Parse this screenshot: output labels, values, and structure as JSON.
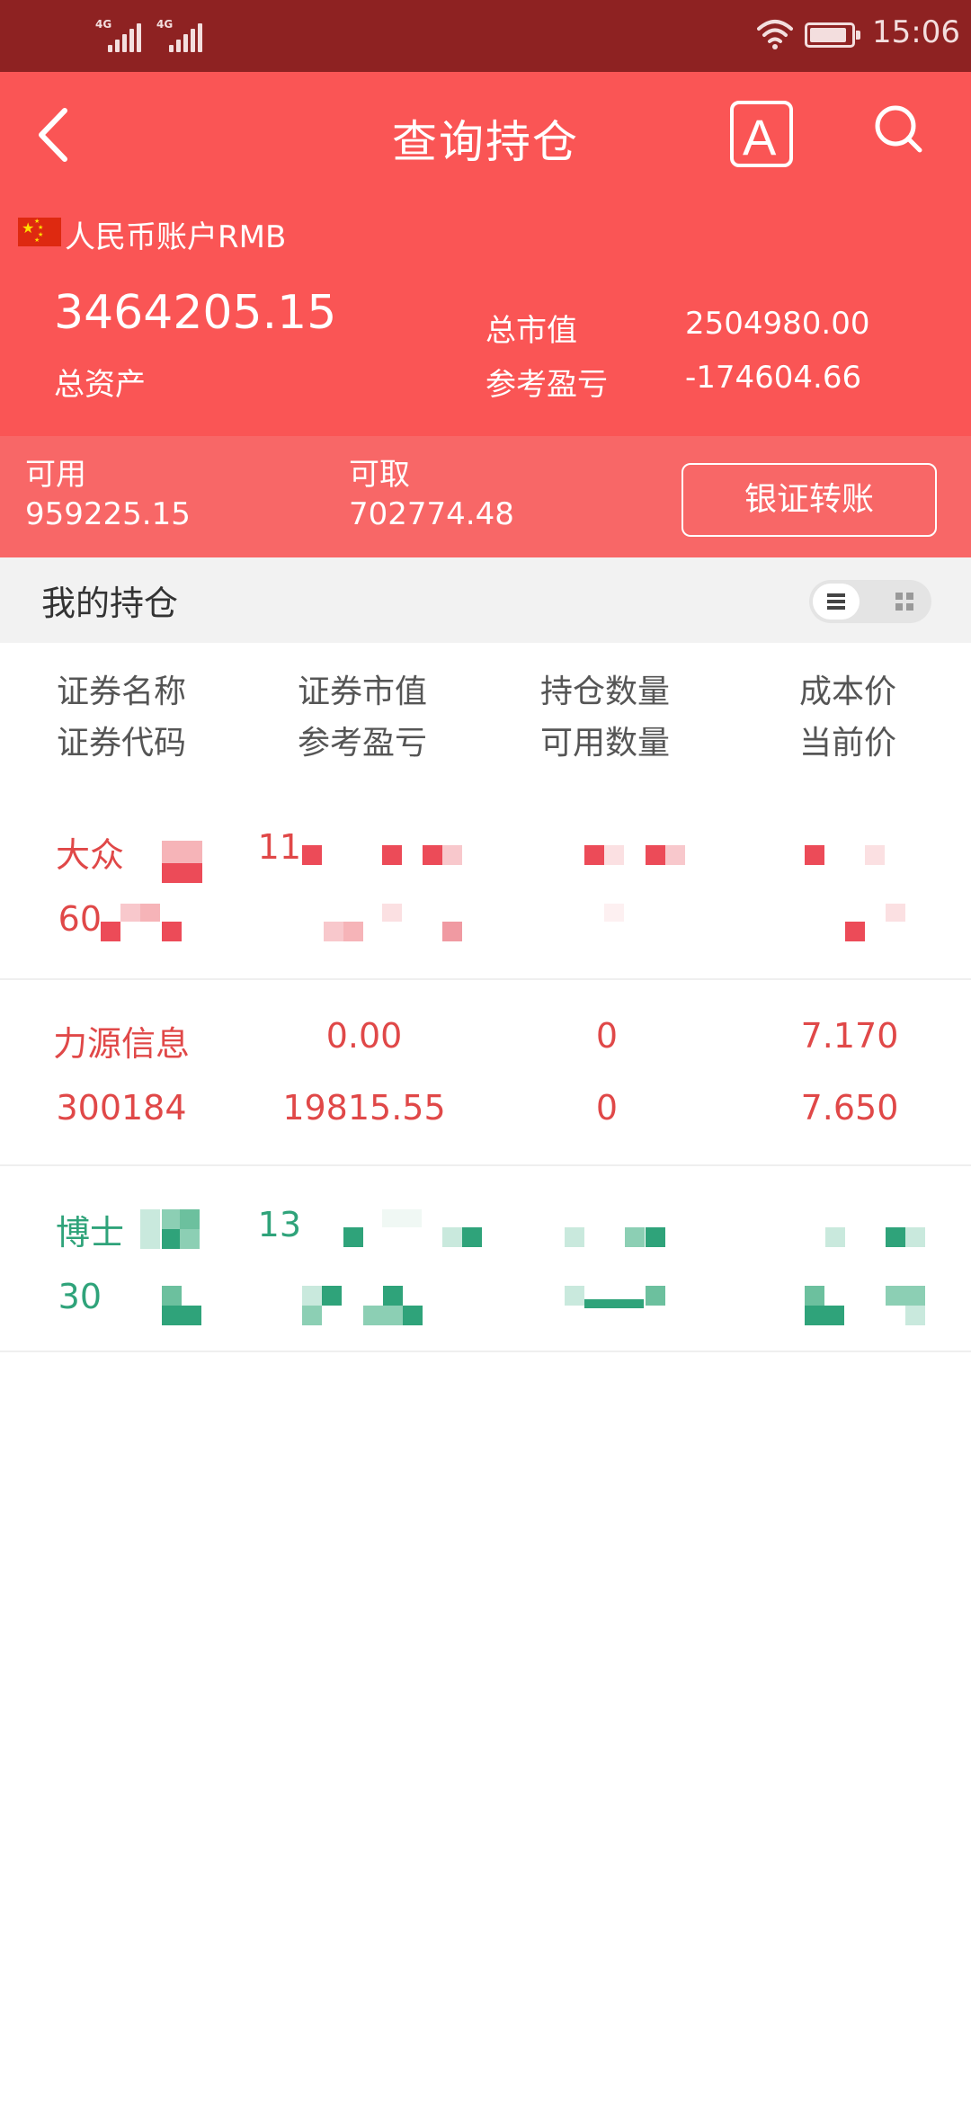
{
  "status_bar": {
    "sim1": "4G",
    "sim2": "4G",
    "time": "15:06",
    "battery_level": 0.9
  },
  "header": {
    "title": "查询持仓",
    "font_button_label": "A"
  },
  "account": {
    "label": "人民币账户RMB",
    "total_assets_value": "3464205.15",
    "total_assets_label": "总资产",
    "market_value_label": "总市值",
    "market_value": "2504980.00",
    "profit_label": "参考盈亏",
    "profit": "-174604.66"
  },
  "funds": {
    "available_label": "可用",
    "available_value": "959225.15",
    "withdrawable_label": "可取",
    "withdrawable_value": "702774.48",
    "transfer_button": "银证转账"
  },
  "holdings": {
    "title": "我的持仓"
  },
  "columns": {
    "c1_line1": "证券名称",
    "c1_line2": "证券代码",
    "c2_line1": "证券市值",
    "c2_line2": "参考盈亏",
    "c3_line1": "持仓数量",
    "c3_line2": "可用数量",
    "c4_line1": "成本价",
    "c4_line2": "当前价"
  },
  "rows": [
    {
      "color": "#e04848",
      "name": "大众",
      "code": "60",
      "market_value": "11",
      "profit": "",
      "quantity": "",
      "available": "",
      "cost": "",
      "price": ""
    },
    {
      "color": "#e04848",
      "name": "力源信息",
      "code": "300184",
      "market_value": "0.00",
      "profit": "19815.55",
      "quantity": "0",
      "available": "0",
      "cost": "7.170",
      "price": "7.650"
    },
    {
      "color": "#2fa37a",
      "name": "博士",
      "code": "30",
      "market_value": "13",
      "profit": "",
      "quantity": "",
      "available": "",
      "cost": "",
      "price": ""
    }
  ]
}
